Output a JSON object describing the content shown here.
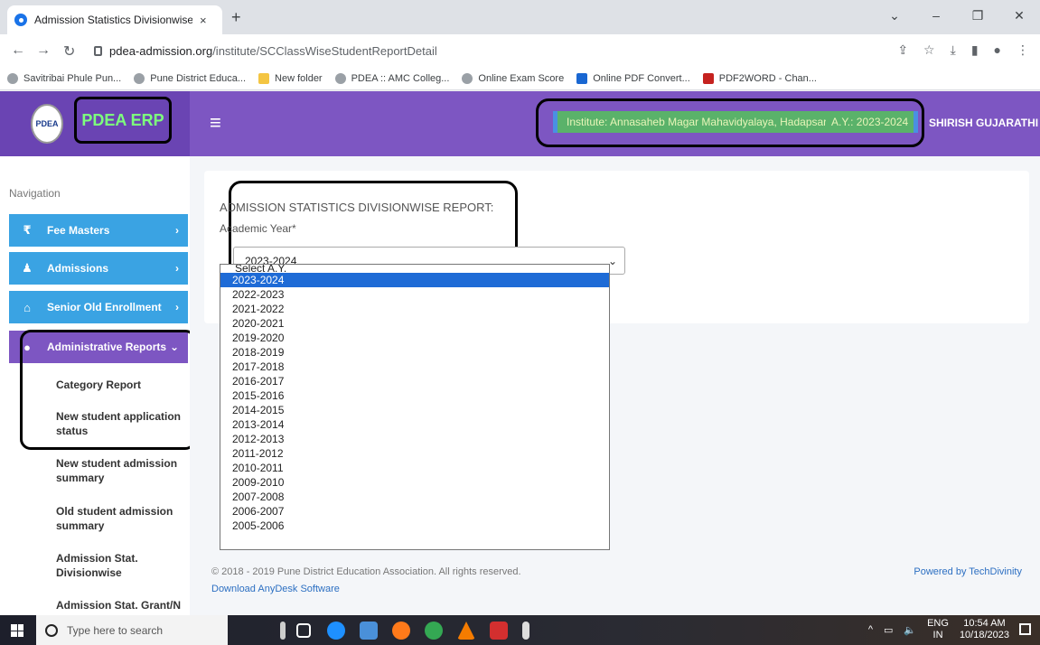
{
  "browser": {
    "tab_title": "Admission Statistics Divisionwise",
    "tab_close": "×",
    "new_tab": "+",
    "url_host": "pdea-admission.org",
    "url_path": "/institute/SCClassWiseStudentReportDetail",
    "window_controls": [
      "⌄",
      "–",
      "❐",
      "✕"
    ],
    "bookmarks": [
      {
        "label": "Savitribai Phule Pun...",
        "icon": "globe"
      },
      {
        "label": "Pune District Educa...",
        "icon": "globe"
      },
      {
        "label": "New folder",
        "icon": "folder"
      },
      {
        "label": "PDEA :: AMC Colleg...",
        "icon": "globe"
      },
      {
        "label": "Online Exam Score",
        "icon": "globe"
      },
      {
        "label": "Online PDF Convert...",
        "icon": "blue"
      },
      {
        "label": "PDF2WORD - Chan...",
        "icon": "pdf"
      }
    ]
  },
  "header": {
    "logo_text": "PDEA",
    "brand": "PDEA ERP",
    "menu_icon": "≡",
    "institute": "Institute: Annasaheb Magar Mahavidyalaya, Hadapsar",
    "academic_year": "A.Y.: 2023-2024",
    "user": "SHIRISH GUJARATHI",
    "accent": "#7d56c2"
  },
  "sidebar": {
    "heading": "Navigation",
    "items": [
      {
        "label": "Fee Masters",
        "icon": "₹",
        "chevron": "›"
      },
      {
        "label": "Admissions",
        "icon": "👤",
        "chevron": "›"
      },
      {
        "label": "Senior Old Enrollment",
        "icon": "🎓",
        "chevron": "›"
      },
      {
        "label": "Administrative Reports",
        "icon": "●",
        "chevron": "⌄"
      }
    ],
    "sub_items": [
      "Category Report",
      "New student application status",
      "New student admission summary",
      "Old student admission summary",
      "Admission Stat. Divisionwise",
      "Admission Stat. Grant/N"
    ]
  },
  "main": {
    "title": "ADMISSION STATISTICS DIVISIONWISE REPORT:",
    "field_label": "Academic Year*",
    "selected_year": "2023-2024",
    "dropdown_placeholder": "Select A.Y.",
    "years": [
      "2023-2024",
      "2022-2023",
      "2021-2022",
      "2020-2021",
      "2019-2020",
      "2018-2019",
      "2017-2018",
      "2016-2017",
      "2015-2016",
      "2014-2015",
      "2013-2014",
      "2012-2013",
      "2011-2012",
      "2010-2011",
      "2009-2010",
      "2007-2008",
      "2006-2007",
      "2005-2006"
    ]
  },
  "footer": {
    "copyright": "© 2018 - 2019 Pune District Education Association. All rights reserved.",
    "download_link": "Download AnyDesk Software",
    "powered_by": "Powered by TechDivinity"
  },
  "taskbar": {
    "search_placeholder": "Type here to search",
    "lang_top": "ENG",
    "lang_bottom": "IN",
    "time": "10:54 AM",
    "date": "10/18/2023"
  }
}
